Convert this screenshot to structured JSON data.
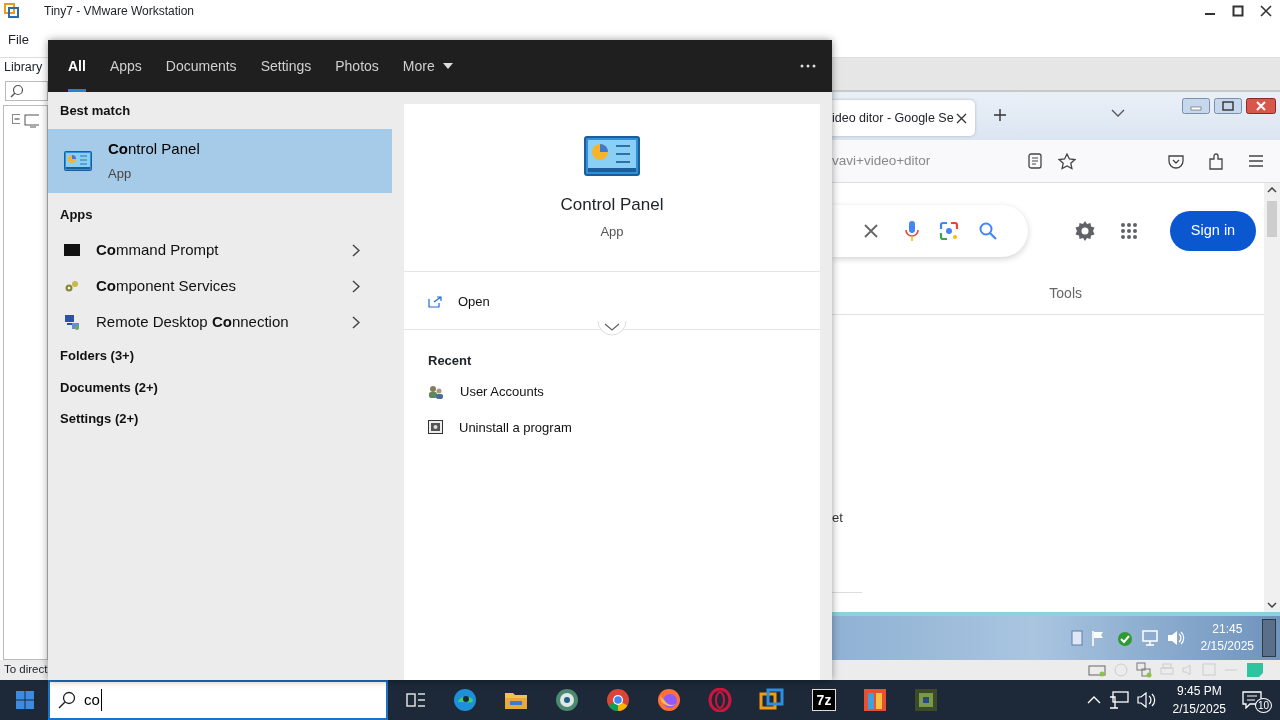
{
  "vmware": {
    "title": "Tiny7 - VMware Workstation",
    "menu": [
      "File"
    ],
    "library_label": "Library",
    "status_text": "To direct"
  },
  "guest": {
    "browser": {
      "tab_title": "ideo ditor - Google Se",
      "address": "vavi+video+ditor",
      "sign_in": "Sign in",
      "tools": "Tools",
      "fragment": "et"
    },
    "taskbar": {
      "time": "21:45",
      "date": "2/15/2025"
    }
  },
  "search_panel": {
    "tabs": [
      {
        "label": "All",
        "selected": true
      },
      {
        "label": "Apps",
        "selected": false
      },
      {
        "label": "Documents",
        "selected": false
      },
      {
        "label": "Settings",
        "selected": false
      },
      {
        "label": "Photos",
        "selected": false
      },
      {
        "label": "More",
        "selected": false,
        "kind": "dropdown"
      }
    ],
    "best_match": {
      "heading": "Best match",
      "name": "**Co**ntrol Panel",
      "type": "App",
      "selected": true
    },
    "apps": {
      "heading": "Apps",
      "items": [
        {
          "name": "**Co**mmand Prompt",
          "kind": "console"
        },
        {
          "name": "**Co**mponent Services",
          "kind": "services"
        },
        {
          "name": "Remote Desktop **Co**nnection",
          "kind": "remote"
        }
      ]
    },
    "categories": [
      "Folders (3+)",
      "Documents (2+)",
      "Settings (2+)"
    ],
    "preview": {
      "name": "Control Panel",
      "type": "App",
      "action": "Open",
      "recent_heading": "Recent",
      "recent": [
        {
          "label": "User Accounts",
          "kind": "users"
        },
        {
          "label": "Uninstall a program",
          "kind": "uninstall"
        }
      ]
    }
  },
  "taskbar": {
    "search_value": "co",
    "seven_zip": "7z",
    "time": "9:45 PM",
    "date": "2/15/2025",
    "notifications": "10"
  }
}
